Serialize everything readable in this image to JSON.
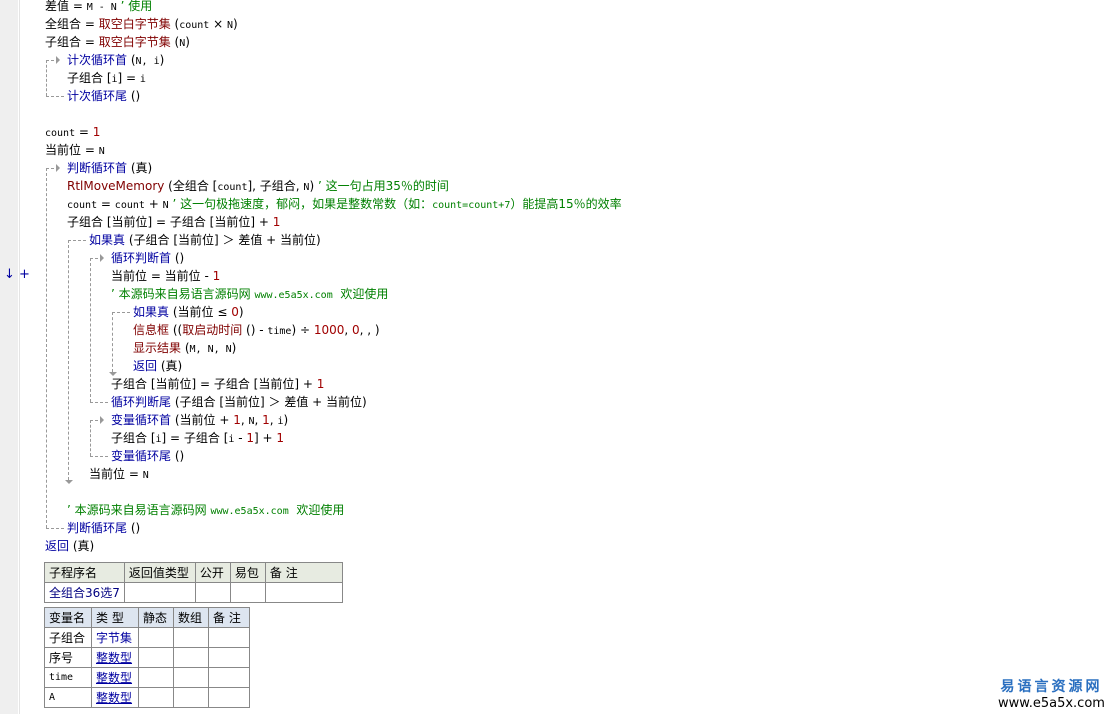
{
  "code_lines": [
    {
      "indent": 0,
      "tokens": [
        [
          "t",
          "差值 = "
        ],
        [
          "m",
          "M - N"
        ],
        [
          "c",
          " ’ 使用"
        ]
      ]
    },
    {
      "indent": 0,
      "tokens": [
        [
          "t",
          "全组合 = "
        ],
        [
          "f",
          "取空白字节集"
        ],
        [
          "t",
          " ("
        ],
        [
          "m",
          "count"
        ],
        [
          "t",
          " × "
        ],
        [
          "m",
          "N"
        ],
        [
          "t",
          ")"
        ]
      ]
    },
    {
      "indent": 0,
      "tokens": [
        [
          "t",
          "子组合 = "
        ],
        [
          "f",
          "取空白字节集"
        ],
        [
          "t",
          " ("
        ],
        [
          "m",
          "N"
        ],
        [
          "t",
          ")"
        ]
      ]
    },
    {
      "indent": 1,
      "tokens": [
        [
          "k",
          "计次循环首"
        ],
        [
          "t",
          " ("
        ],
        [
          "m",
          "N, i"
        ],
        [
          "t",
          ")"
        ]
      ]
    },
    {
      "indent": 1,
      "tokens": [
        [
          "t",
          "子组合 ["
        ],
        [
          "m",
          "i"
        ],
        [
          "t",
          "] = "
        ],
        [
          "m",
          "i"
        ]
      ]
    },
    {
      "indent": 1,
      "tokens": [
        [
          "k",
          "计次循环尾"
        ],
        [
          "t",
          " ()"
        ]
      ]
    },
    {
      "indent": 0,
      "tokens": []
    },
    {
      "indent": 0,
      "tokens": [
        [
          "m",
          "count"
        ],
        [
          "t",
          " = "
        ],
        [
          "n",
          "1"
        ]
      ]
    },
    {
      "indent": 0,
      "tokens": [
        [
          "t",
          "当前位 = "
        ],
        [
          "m",
          "N"
        ]
      ]
    },
    {
      "indent": 1,
      "tokens": [
        [
          "k",
          "判断循环首"
        ],
        [
          "t",
          " (真)"
        ]
      ]
    },
    {
      "indent": 1,
      "tokens": [
        [
          "f",
          "RtlMoveMemory"
        ],
        [
          "t",
          " (全组合 ["
        ],
        [
          "m",
          "count"
        ],
        [
          "t",
          "], 子组合, "
        ],
        [
          "m",
          "N"
        ],
        [
          "t",
          ")"
        ],
        [
          "c",
          " ’ 这一句占用35％的时间"
        ]
      ]
    },
    {
      "indent": 1,
      "tokens": [
        [
          "m",
          "count"
        ],
        [
          "t",
          " = "
        ],
        [
          "m",
          "count"
        ],
        [
          "t",
          " + "
        ],
        [
          "m",
          "N"
        ],
        [
          "c",
          " ’ 这一句极拖速度，郁闷，如果是整数常数（如："
        ],
        [
          "c m",
          "count=count+7"
        ],
        [
          "c",
          "）能提高15％的效率"
        ]
      ]
    },
    {
      "indent": 1,
      "tokens": [
        [
          "t",
          "子组合 [当前位] = 子组合 [当前位] + "
        ],
        [
          "n",
          "1"
        ]
      ]
    },
    {
      "indent": 2,
      "tokens": [
        [
          "k",
          "如果真"
        ],
        [
          "t",
          " (子组合 [当前位] ＞ 差值 + 当前位)"
        ]
      ]
    },
    {
      "indent": 3,
      "tokens": [
        [
          "k",
          "循环判断首"
        ],
        [
          "t",
          " ()"
        ]
      ]
    },
    {
      "indent": 3,
      "tokens": [
        [
          "t",
          "当前位 = 当前位 - "
        ],
        [
          "n",
          "1"
        ]
      ]
    },
    {
      "indent": 3,
      "tokens": [
        [
          "c",
          "’ 本源码来自易语言源码网 "
        ],
        [
          "c m",
          "www.e5a5x.com"
        ],
        [
          "c",
          "  欢迎使用"
        ]
      ]
    },
    {
      "indent": 4,
      "tokens": [
        [
          "k",
          "如果真"
        ],
        [
          "t",
          " (当前位 ≤ "
        ],
        [
          "n",
          "0"
        ],
        [
          "t",
          ")"
        ]
      ]
    },
    {
      "indent": 4,
      "tokens": [
        [
          "f",
          "信息框"
        ],
        [
          "t",
          " (("
        ],
        [
          "f",
          "取启动时间"
        ],
        [
          "t",
          " () - "
        ],
        [
          "m",
          "time"
        ],
        [
          "t",
          ") ÷ "
        ],
        [
          "n",
          "1000"
        ],
        [
          "t",
          ", "
        ],
        [
          "n",
          "0"
        ],
        [
          "t",
          ", , )"
        ]
      ]
    },
    {
      "indent": 4,
      "tokens": [
        [
          "f",
          "显示结果"
        ],
        [
          "t",
          " ("
        ],
        [
          "m",
          "M, N, N"
        ],
        [
          "t",
          ")"
        ]
      ]
    },
    {
      "indent": 4,
      "tokens": [
        [
          "k",
          "返回"
        ],
        [
          "t",
          " (真)"
        ]
      ]
    },
    {
      "indent": 3,
      "tokens": [
        [
          "t",
          "子组合 [当前位] = 子组合 [当前位] + "
        ],
        [
          "n",
          "1"
        ]
      ]
    },
    {
      "indent": 3,
      "tokens": [
        [
          "k",
          "循环判断尾"
        ],
        [
          "t",
          " (子组合 [当前位] ＞ 差值 + 当前位)"
        ]
      ]
    },
    {
      "indent": 3,
      "tokens": [
        [
          "k",
          "变量循环首"
        ],
        [
          "t",
          " (当前位 + "
        ],
        [
          "n",
          "1"
        ],
        [
          "t",
          ", "
        ],
        [
          "m",
          "N"
        ],
        [
          "t",
          ", "
        ],
        [
          "n",
          "1"
        ],
        [
          "t",
          ", "
        ],
        [
          "m",
          "i"
        ],
        [
          "t",
          ")"
        ]
      ]
    },
    {
      "indent": 3,
      "tokens": [
        [
          "t",
          "子组合 ["
        ],
        [
          "m",
          "i"
        ],
        [
          "t",
          "] = 子组合 ["
        ],
        [
          "m",
          "i"
        ],
        [
          "t",
          " - "
        ],
        [
          "n",
          "1"
        ],
        [
          "t",
          "] + "
        ],
        [
          "n",
          "1"
        ]
      ]
    },
    {
      "indent": 3,
      "tokens": [
        [
          "k",
          "变量循环尾"
        ],
        [
          "t",
          " ()"
        ]
      ]
    },
    {
      "indent": 2,
      "tokens": [
        [
          "t",
          "当前位 = "
        ],
        [
          "m",
          "N"
        ]
      ]
    },
    {
      "indent": 0,
      "tokens": []
    },
    {
      "indent": 1,
      "tokens": [
        [
          "c",
          "’ 本源码来自易语言源码网 "
        ],
        [
          "c m",
          "www.e5a5x.com"
        ],
        [
          "c",
          "  欢迎使用"
        ]
      ]
    },
    {
      "indent": 1,
      "tokens": [
        [
          "k",
          "判断循环尾"
        ],
        [
          "t",
          " ()"
        ]
      ]
    },
    {
      "indent": 0,
      "tokens": [
        [
          "k",
          "返回"
        ],
        [
          "t",
          " (真)"
        ]
      ]
    }
  ],
  "gutter_marker": "↓ +",
  "sub_table": {
    "headers": [
      "子程序名",
      "返回值类型",
      "公开",
      "易包",
      "备 注"
    ],
    "row": [
      "全组合36选7",
      "",
      "",
      "",
      ""
    ]
  },
  "var_table": {
    "headers": [
      "变量名",
      "类 型",
      "静态",
      "数组",
      "备 注"
    ],
    "rows": [
      [
        "子组合",
        "字节集",
        "",
        "",
        ""
      ],
      [
        "序号",
        "整数型",
        "",
        "",
        ""
      ],
      [
        "time",
        "整数型",
        "",
        "",
        ""
      ],
      [
        "A",
        "整数型",
        "",
        "",
        ""
      ]
    ]
  },
  "watermark": {
    "name": "易语言资源网",
    "url": "www.e5a5x.com"
  },
  "colors": {
    "keyword": "#0000a0",
    "function": "#800000",
    "number": "#a00000",
    "comment": "#008000"
  }
}
